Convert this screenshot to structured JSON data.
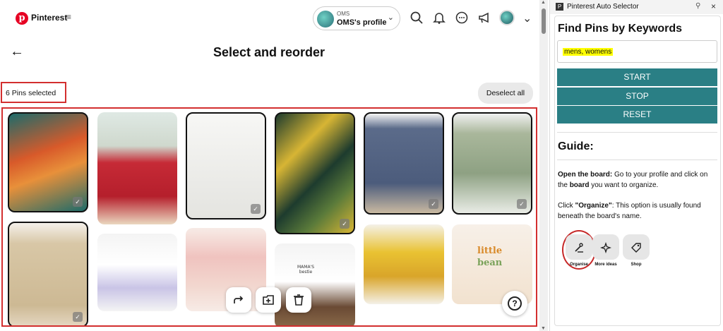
{
  "topbar": {
    "brand": "Pinterest",
    "profile_small": "OMS",
    "profile_name": "OMS's profile"
  },
  "page": {
    "title": "Select and reorder",
    "selected_count": "6 Pins selected",
    "deselect_label": "Deselect all"
  },
  "pins": [
    {
      "label": "pin-floral-dress-tropical",
      "colors": [
        "#d85a2a",
        "#1d6b6a"
      ],
      "selected": true
    },
    {
      "label": "pin-red-floral-sundress",
      "colors": [
        "#c62a36",
        "#ead7bf"
      ],
      "selected": false
    },
    {
      "label": "pin-white-shorts",
      "colors": [
        "#f2f2ef",
        "#dcdcd8"
      ],
      "selected": true
    },
    {
      "label": "pin-tropical-shirt-set",
      "colors": [
        "#1d3b2e",
        "#d7b534"
      ],
      "selected": true
    },
    {
      "label": "pin-blue-denim-shirt",
      "colors": [
        "#5b6b8a",
        "#c9b9a1"
      ],
      "selected": true
    },
    {
      "label": "pin-leaf-print-shirt",
      "colors": [
        "#a9b79b",
        "#e9ece6"
      ],
      "selected": true
    },
    {
      "label": "pin-beige-shirt-shorts",
      "colors": [
        "#d8c7a6",
        "#f2ece2"
      ],
      "selected": true
    },
    {
      "label": "pin-baby-bow-set",
      "colors": [
        "#f4f4f4",
        "#c9c4e6"
      ],
      "selected": false
    },
    {
      "label": "pin-baby-pink-romper",
      "colors": [
        "#f0c3bf",
        "#f7ebe6"
      ],
      "selected": false
    },
    {
      "label": "pin-mamas-bestie-set",
      "colors": [
        "#f4f4f4",
        "#6a4a34"
      ],
      "selected": false
    },
    {
      "label": "pin-yellow-sunflower-dress",
      "colors": [
        "#e9c232",
        "#f4f1e8"
      ],
      "selected": false
    },
    {
      "label": "pin-little-bean-romper",
      "colors": [
        "#f2e2cf",
        "#e39b3a"
      ],
      "selected": false
    }
  ],
  "mamas_text": "MAMA'S bestie",
  "little_text": "little",
  "bean_text": "bean",
  "toolbar": {
    "move_icon": "arrow-share-icon",
    "add_board_icon": "add-to-board-icon",
    "delete_icon": "trash-icon"
  },
  "help_label": "?",
  "extension": {
    "window_title": "Pinterest Auto Selector",
    "heading": "Find Pins by Keywords",
    "keywords": "mens, womens",
    "start": "START",
    "stop": "STOP",
    "reset": "RESET",
    "guide_heading": "Guide:",
    "p1_bold": "Open the board:",
    "p1_text": " Go to your profile and click on the ",
    "p1_bold2": "board",
    "p1_text2": " you want to organize.",
    "p2_text1": "Click ",
    "p2_bold": "\"Organize\"",
    "p2_text2": ": This option is usually found beneath the board's name.",
    "opt1": "Organise",
    "opt2": "More ideas",
    "opt3": "Shop"
  }
}
